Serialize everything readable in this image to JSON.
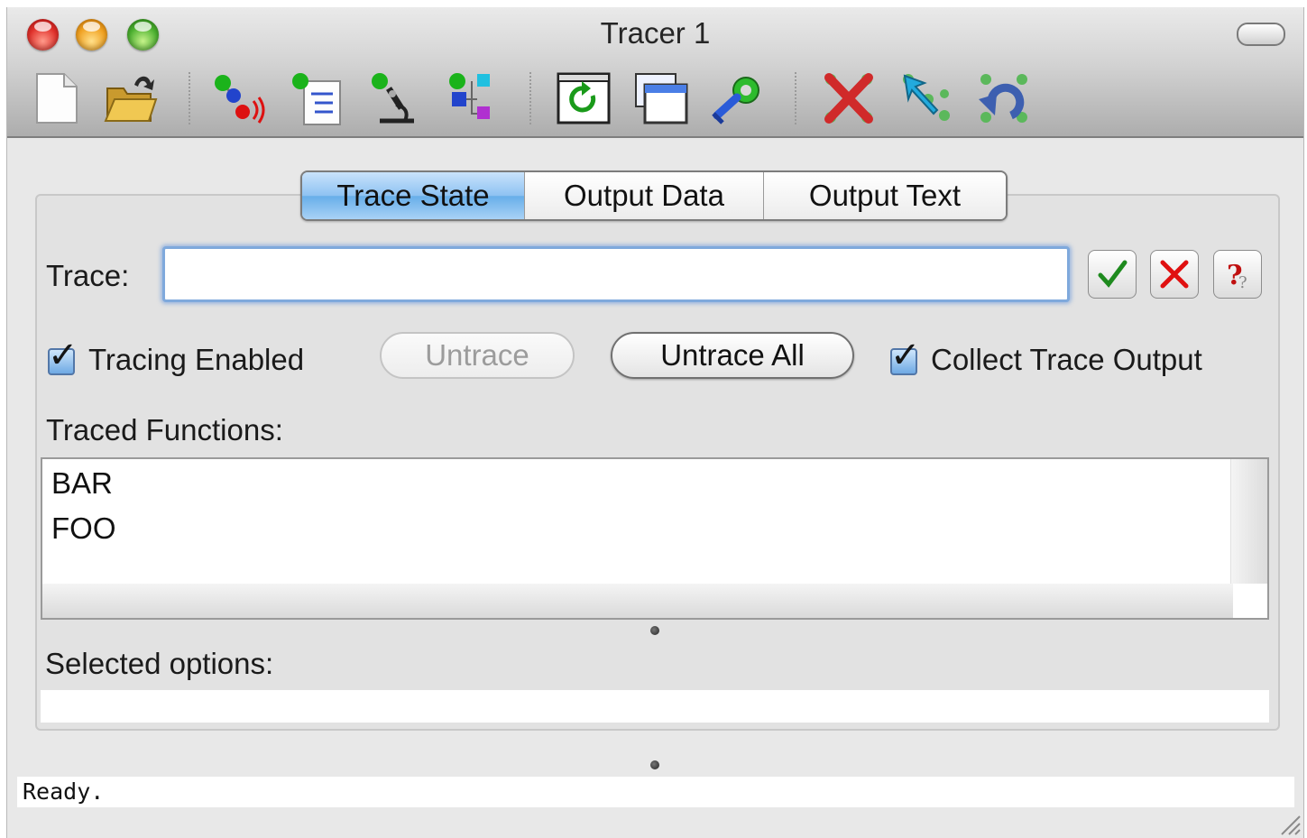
{
  "window": {
    "title": "Tracer 1"
  },
  "toolbar": {
    "groups": [
      [
        "new-document-icon",
        "open-folder-icon"
      ],
      [
        "trace-signal-icon",
        "trace-list-icon",
        "inspect-microscope-icon",
        "trace-tree-icon"
      ],
      [
        "refresh-icon",
        "new-window-icon",
        "settings-gear-icon"
      ],
      [
        "untrace-x-icon",
        "trace-arrow-icon",
        "undo-trace-icon"
      ]
    ]
  },
  "tabs": [
    {
      "label": "Trace State",
      "active": true
    },
    {
      "label": "Output Data",
      "active": false
    },
    {
      "label": "Output Text",
      "active": false
    }
  ],
  "trace": {
    "label": "Trace:",
    "value": "",
    "placeholder": ""
  },
  "input_buttons": [
    "accept-check-icon",
    "cancel-x-icon",
    "help-question-icon"
  ],
  "tracing_enabled": {
    "label": "Tracing Enabled",
    "checked": true
  },
  "untrace_button": {
    "label": "Untrace",
    "enabled": false
  },
  "untrace_all_button": {
    "label": "Untrace All",
    "enabled": true
  },
  "collect_output": {
    "label": "Collect Trace Output",
    "checked": true
  },
  "traced_functions": {
    "label": "Traced Functions:",
    "items": [
      "BAR",
      "FOO"
    ]
  },
  "selected_options": {
    "label": "Selected options:",
    "value": ""
  },
  "status": {
    "text": "Ready."
  },
  "colors": {
    "accent": "#6aaee9",
    "focus_ring": "#7fa9dc",
    "cancel_red": "#e01010",
    "check_green": "#1e8a1e"
  }
}
